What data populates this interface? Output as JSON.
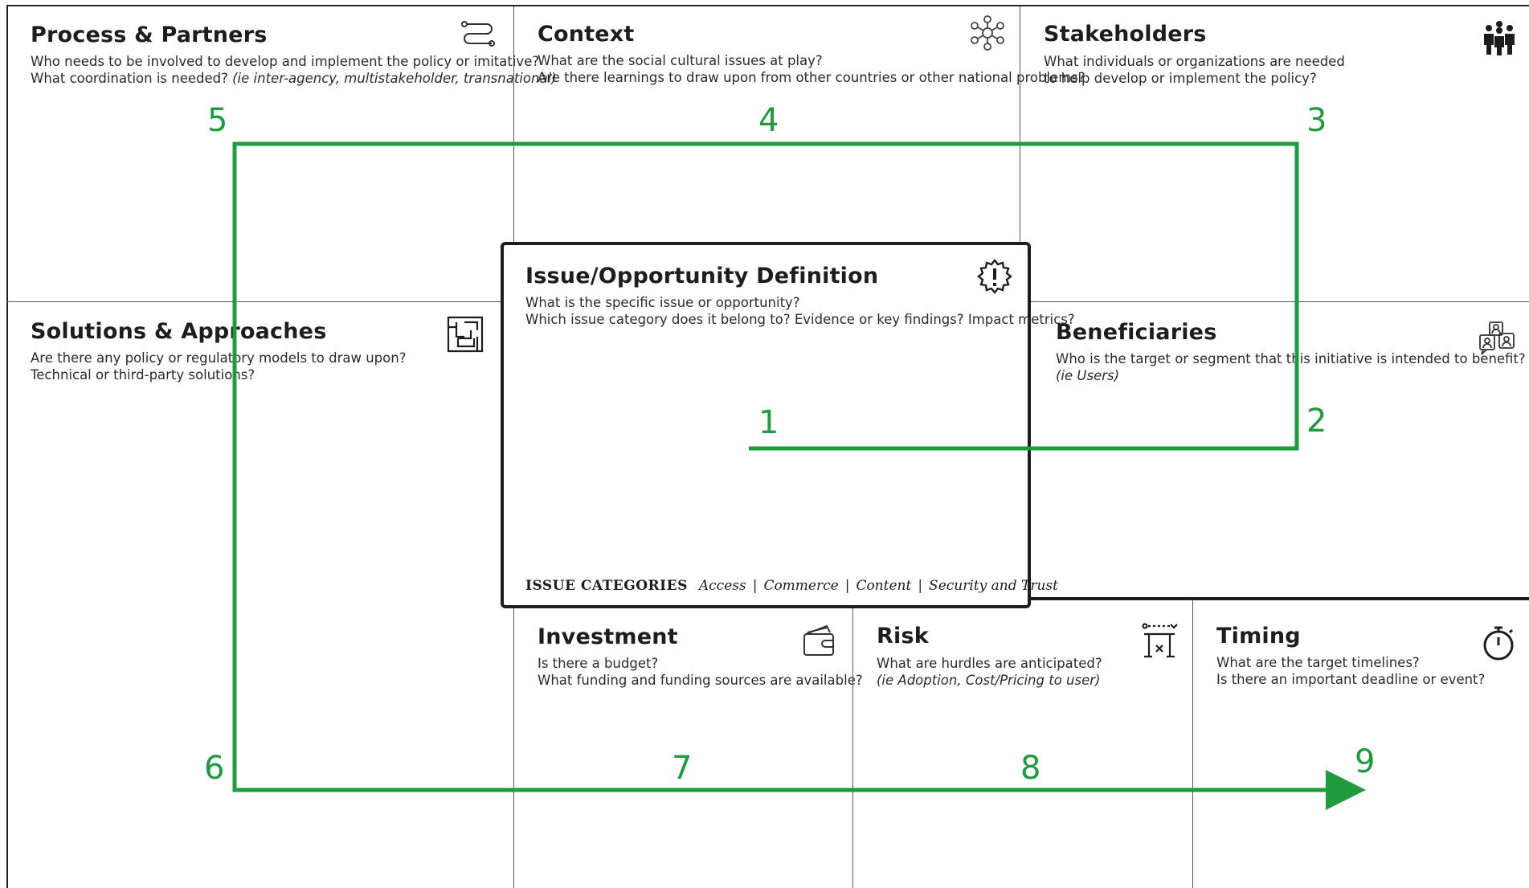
{
  "canvas": {
    "process_partners": {
      "title": "Process & Partners",
      "q1": "Who needs to be involved to develop and implement the policy or imitative?",
      "q2_prefix": "What coordination is needed? ",
      "q2_italic": "(ie inter-agency, multistakeholder, transnational)",
      "icon": "route-icon"
    },
    "context": {
      "title": "Context",
      "q1": "What are the social cultural issues at play?",
      "q2": "Are there learnings to draw upon from other countries or other national problems?",
      "icon": "network-icon"
    },
    "stakeholders": {
      "title": "Stakeholders",
      "q1": "What individuals or organizations are needed",
      "q2": "to help develop or implement the policy?",
      "icon": "people-group-icon"
    },
    "solutions": {
      "title": "Solutions & Approaches",
      "q1": "Are there any policy or regulatory models to draw upon?",
      "q2": "Technical or third-party solutions?",
      "icon": "maze-icon"
    },
    "issue": {
      "title": "Issue/Opportunity Definition",
      "q1": "What is the specific issue or opportunity?",
      "q2": "Which issue category does it belong to? Evidence or key findings? Impact metrics?",
      "icon": "alert-badge-icon",
      "categories_label": "ISSUE CATEGORIES",
      "categories": [
        "Access",
        "Commerce",
        "Content",
        "Security and Trust"
      ]
    },
    "beneficiaries": {
      "title": "Beneficiaries",
      "q1": "Who is the target or segment that this initiative is intended to benefit?",
      "q2_italic": "(ie Users)",
      "icon": "users-chat-icon"
    },
    "investment": {
      "title": "Investment",
      "q1": "Is there a budget?",
      "q2": "What funding and funding sources are available?",
      "icon": "wallet-icon"
    },
    "risk": {
      "title": "Risk",
      "q1": "What are hurdles are anticipated?",
      "q2_italic": "(ie Adoption, Cost/Pricing to user)",
      "icon": "hurdle-icon"
    },
    "timing": {
      "title": "Timing",
      "q1": "What are the target timelines?",
      "q2": "Is there an important deadline or event?",
      "icon": "stopwatch-icon"
    }
  },
  "flow": {
    "color": "#1e9b3c",
    "steps": [
      "1",
      "2",
      "3",
      "4",
      "5",
      "6",
      "7",
      "8",
      "9"
    ]
  },
  "colors": {
    "ink": "#1d1d1b",
    "flow_green": "#1e9b3c",
    "background": "#ffffff"
  }
}
